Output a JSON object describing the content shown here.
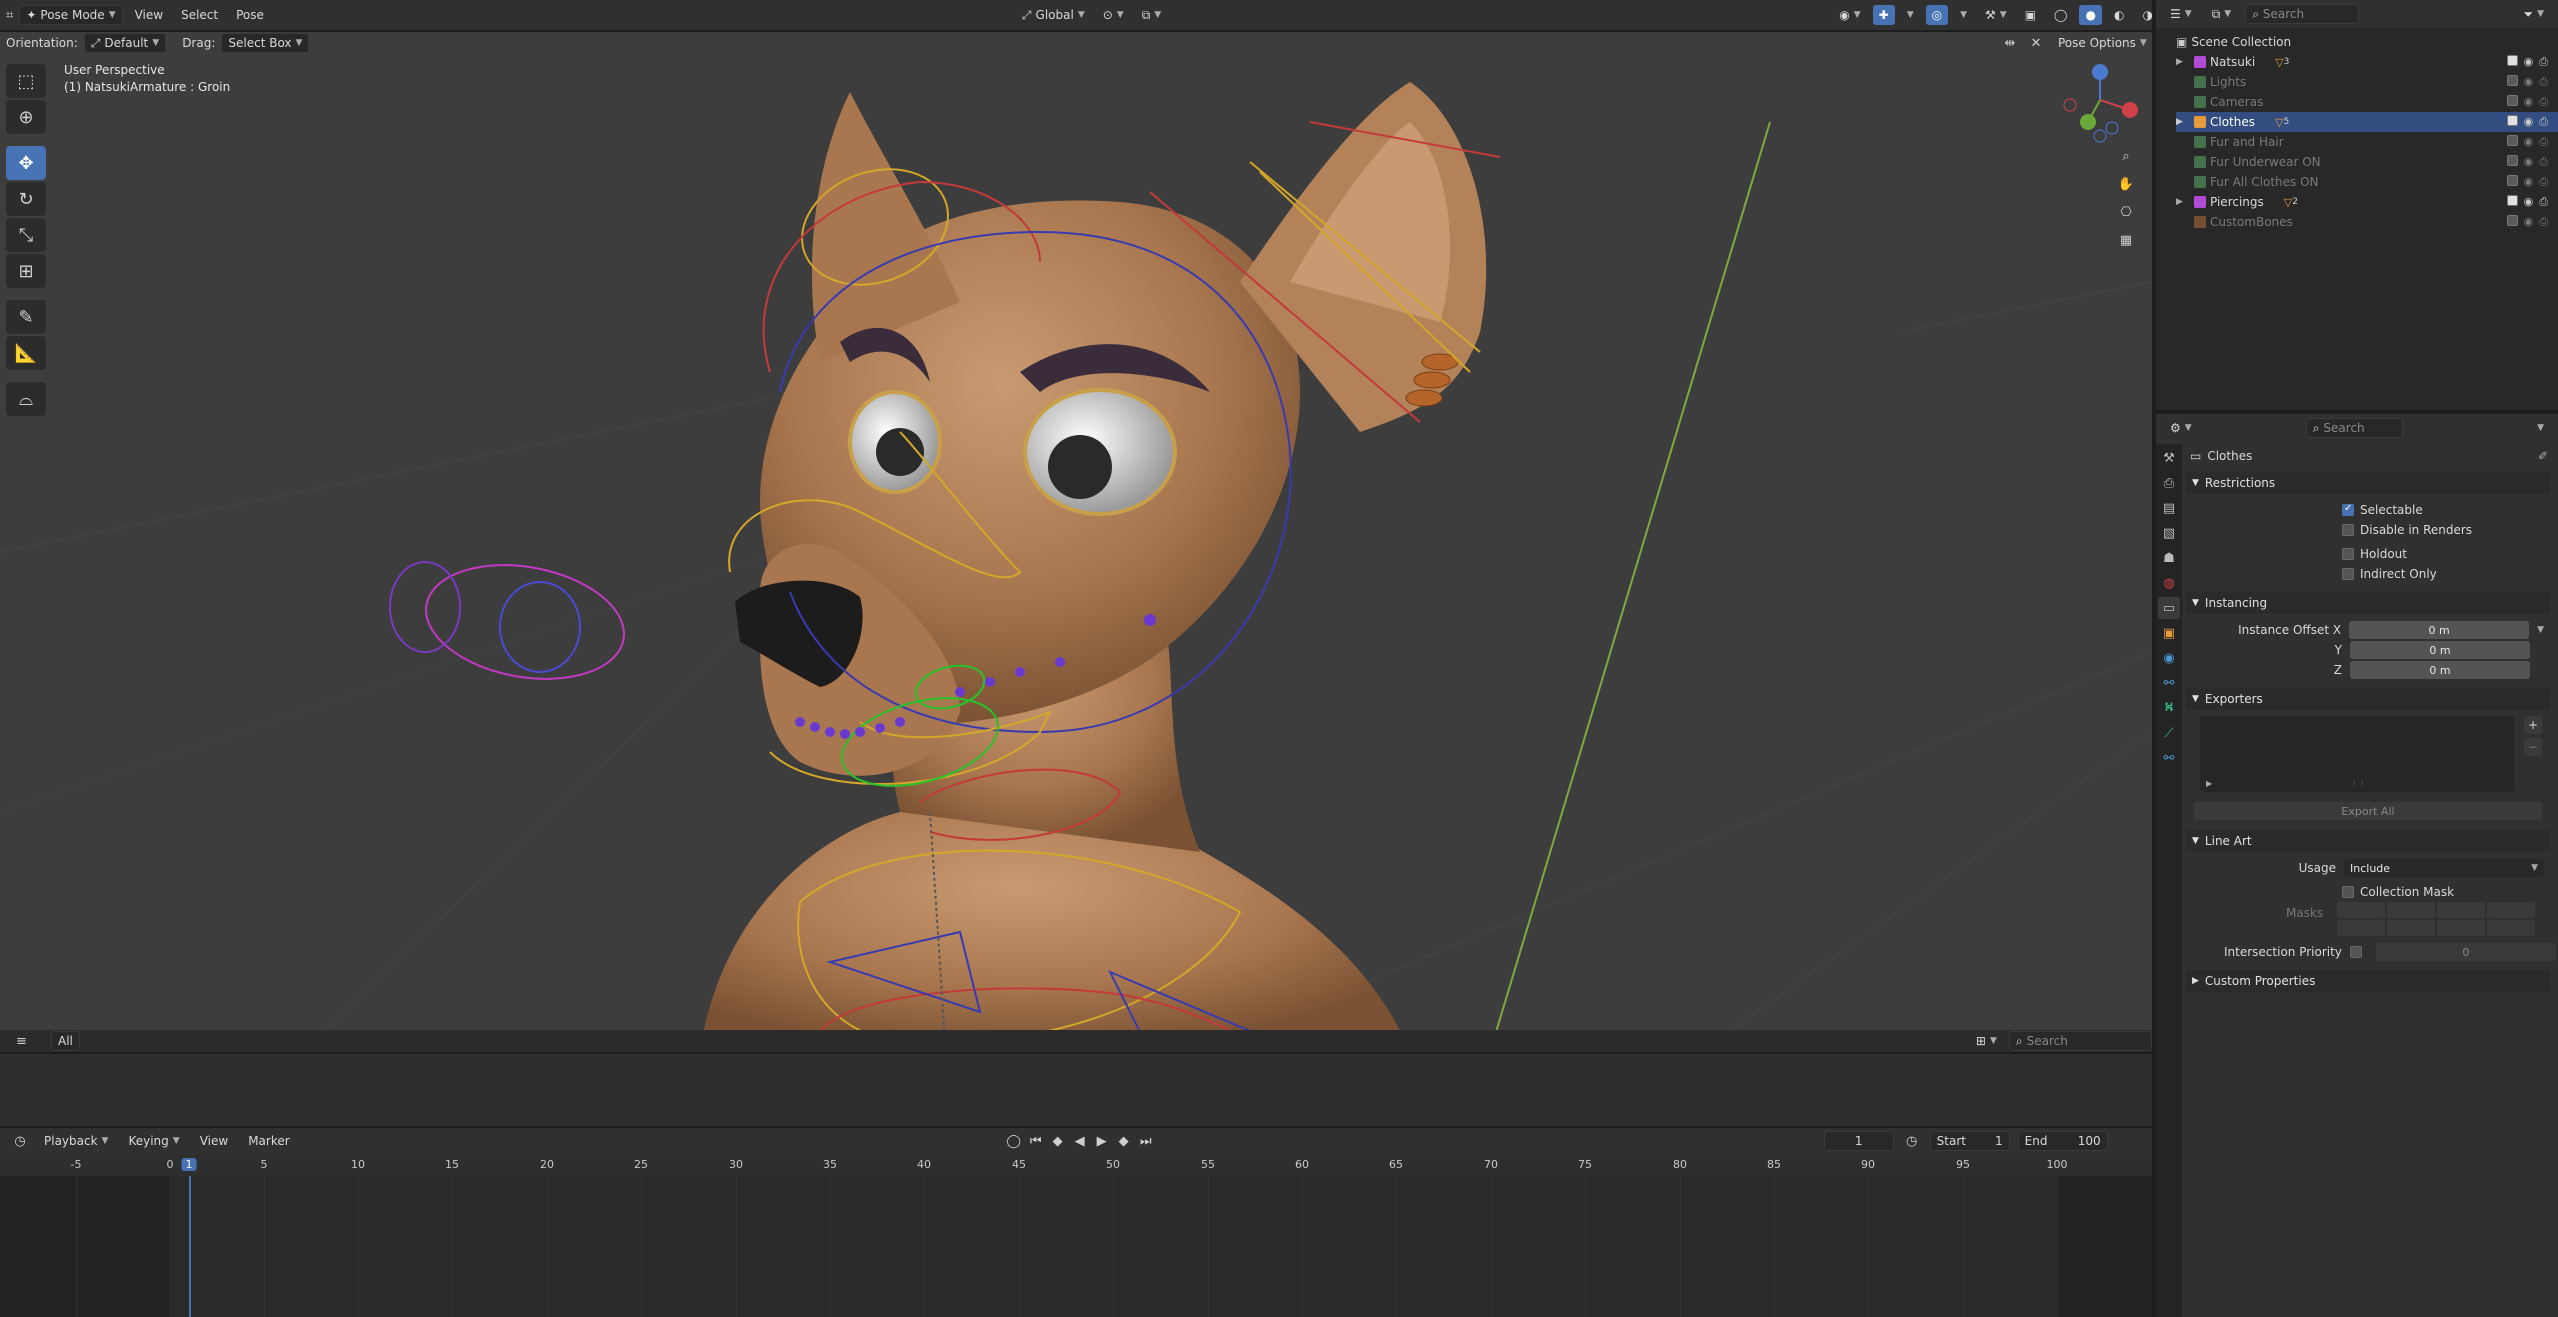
{
  "header": {
    "mode": "Pose Mode",
    "menus": [
      "View",
      "Select",
      "Pose"
    ],
    "transform_orientation": "Global",
    "orientation_label": "Orientation:",
    "orientation_value": "Default",
    "drag_label": "Drag:",
    "drag_value": "Select Box",
    "pose_options": "Pose Options"
  },
  "viewport": {
    "perspective": "User Perspective",
    "active_object": "(1) NatsukiArmature : Groin"
  },
  "outliner": {
    "search_placeholder": "Search",
    "root": "Scene Collection",
    "items": [
      {
        "name": "Natsuki",
        "color": "#b24cd6",
        "enabled": true,
        "expand": true,
        "badge": "3"
      },
      {
        "name": "Lights",
        "color": "#58a064",
        "enabled": false,
        "expand": false,
        "badge": ""
      },
      {
        "name": "Cameras",
        "color": "#58a064",
        "enabled": false,
        "expand": false,
        "badge": ""
      },
      {
        "name": "Clothes",
        "color": "#e69a3c",
        "enabled": true,
        "expand": true,
        "badge": "5"
      },
      {
        "name": "Fur and Hair",
        "color": "#58a064",
        "enabled": false,
        "expand": false,
        "badge": ""
      },
      {
        "name": "Fur Underwear ON",
        "color": "#58a064",
        "enabled": false,
        "expand": false,
        "badge": ""
      },
      {
        "name": "Fur All Clothes ON",
        "color": "#58a064",
        "enabled": false,
        "expand": false,
        "badge": ""
      },
      {
        "name": "Piercings",
        "color": "#b24cd6",
        "enabled": true,
        "expand": true,
        "badge": "2"
      },
      {
        "name": "CustomBones",
        "color": "#a86a3c",
        "enabled": false,
        "expand": false,
        "badge": ""
      }
    ]
  },
  "properties": {
    "search_placeholder": "Search",
    "collection_name": "Clothes",
    "restrictions": {
      "title": "Restrictions",
      "selectable": "Selectable",
      "disable_in_renders": "Disable in Renders",
      "holdout": "Holdout",
      "indirect_only": "Indirect Only"
    },
    "instancing": {
      "title": "Instancing",
      "offset_x_label": "Instance Offset X",
      "y_label": "Y",
      "z_label": "Z",
      "x": "0 m",
      "y": "0 m",
      "z": "0 m"
    },
    "exporters": {
      "title": "Exporters",
      "export_all": "Export All"
    },
    "line_art": {
      "title": "Line Art",
      "usage_label": "Usage",
      "usage_value": "Include",
      "collection_mask": "Collection Mask",
      "masks_label": "Masks",
      "intersection_label": "Intersection Priority",
      "intersection_value": "0"
    },
    "custom_properties": "Custom Properties"
  },
  "footer_bar": {
    "tab": "All",
    "search_placeholder": "Search"
  },
  "timeline": {
    "menus": [
      "Playback",
      "Keying",
      "View",
      "Marker"
    ],
    "current_frame": "1",
    "start_label": "Start",
    "start_value": "1",
    "end_label": "End",
    "end_value": "100",
    "ticks": [
      "-5",
      "0",
      "1",
      "5",
      "10",
      "15",
      "20",
      "25",
      "30",
      "35",
      "40",
      "45",
      "50",
      "55",
      "60",
      "65",
      "70",
      "75",
      "80",
      "85",
      "90",
      "95",
      "100"
    ]
  }
}
